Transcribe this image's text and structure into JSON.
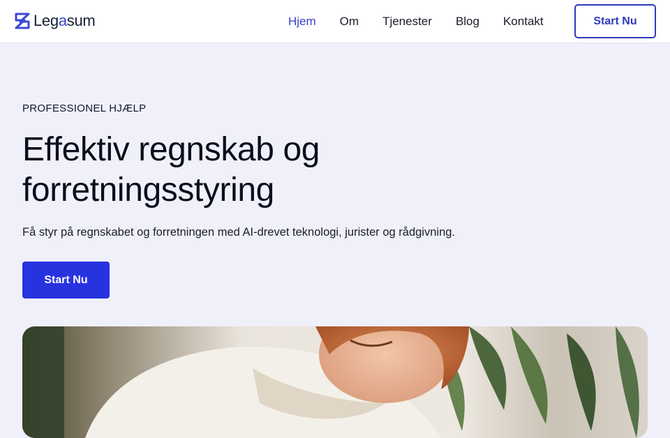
{
  "brand": {
    "logo_prefix": "Leg",
    "logo_accent": "a",
    "logo_suffix": "sum"
  },
  "nav": {
    "items": [
      {
        "label": "Hjem",
        "active": true
      },
      {
        "label": "Om"
      },
      {
        "label": "Tjenester"
      },
      {
        "label": "Blog"
      },
      {
        "label": "Kontakt"
      }
    ],
    "cta_label": "Start Nu"
  },
  "hero": {
    "eyebrow": "PROFESSIONEL HJÆLP",
    "headline_line1": "Effektiv regnskab og",
    "headline_line2": "forretningsstyring",
    "subtext": "Få styr på regnskabet og forretningen med AI-drevet teknologi, jurister og rådgivning.",
    "cta_label": "Start Nu"
  },
  "colors": {
    "brand_blue": "#2833e0",
    "nav_active": "#3740c9",
    "page_bg": "#f0f0fb"
  }
}
